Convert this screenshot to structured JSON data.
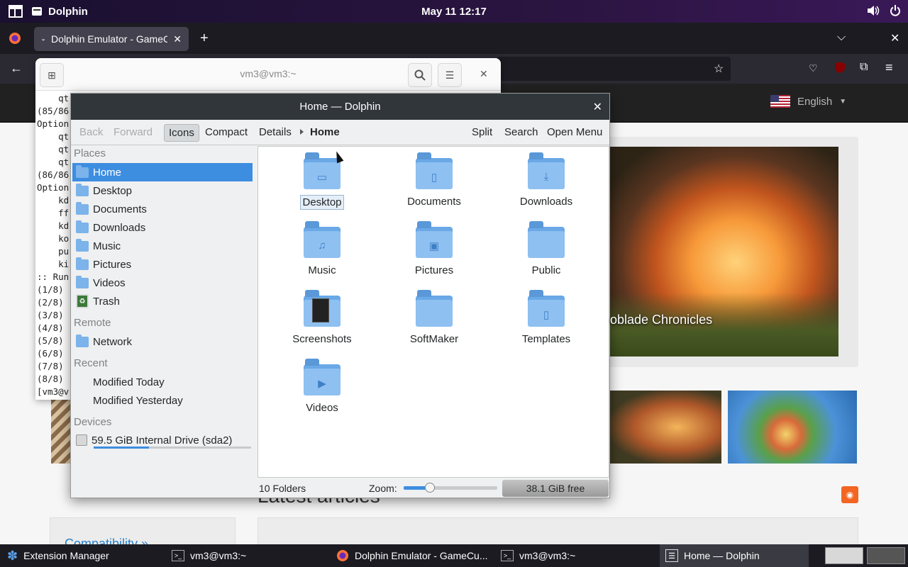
{
  "topbar": {
    "app_name": "Dolphin",
    "clock": "May 11  12:17"
  },
  "firefox": {
    "tab_title": "Dolphin Emulator - GameCube/Wii Emulator"
  },
  "website": {
    "language": "English",
    "hero_caption": "oblade Chronicles",
    "latest_heading": "Latest articles",
    "compat_link": "Compatibility »"
  },
  "terminal": {
    "title": "vm3@vm3:~",
    "lines": [
      "    qt",
      "(85/86",
      "Option",
      "    qt",
      "    qt",
      "    qt",
      "(86/86",
      "Option",
      "    kd",
      "    ff",
      "    kd",
      "    ko",
      "    pu",
      "    ki",
      ":: Run",
      "(1/8)",
      "(2/8)",
      "(3/8)",
      "(4/8)",
      "(5/8)",
      "(6/8)",
      "(7/8)",
      "(8/8)",
      "[vm3@v"
    ]
  },
  "dolphin": {
    "title": "Home — Dolphin",
    "toolbar": {
      "back": "Back",
      "forward": "Forward",
      "icons": "Icons",
      "compact": "Compact",
      "details": "Details",
      "breadcrumb": "Home",
      "split": "Split",
      "search": "Search",
      "open_menu": "Open Menu"
    },
    "sections": {
      "places": "Places",
      "remote": "Remote",
      "recent": "Recent",
      "devices": "Devices"
    },
    "places": [
      "Home",
      "Desktop",
      "Documents",
      "Downloads",
      "Music",
      "Pictures",
      "Videos",
      "Trash"
    ],
    "remote": [
      "Network"
    ],
    "recent": [
      "Modified Today",
      "Modified Yesterday"
    ],
    "devices": [
      "59.5 GiB Internal Drive (sda2)"
    ],
    "drive_usage_fraction": 0.35,
    "folders": [
      "Desktop",
      "Documents",
      "Downloads",
      "Music",
      "Pictures",
      "Public",
      "Screenshots",
      "SoftMaker",
      "Templates",
      "Videos"
    ],
    "status": {
      "count": "10 Folders",
      "zoom_label": "Zoom:",
      "free": "38.1 GiB free"
    }
  },
  "taskbar": {
    "items": [
      "Extension Manager",
      "vm3@vm3:~",
      "Dolphin Emulator - GameCu...",
      "vm3@vm3:~",
      "Home — Dolphin"
    ]
  }
}
